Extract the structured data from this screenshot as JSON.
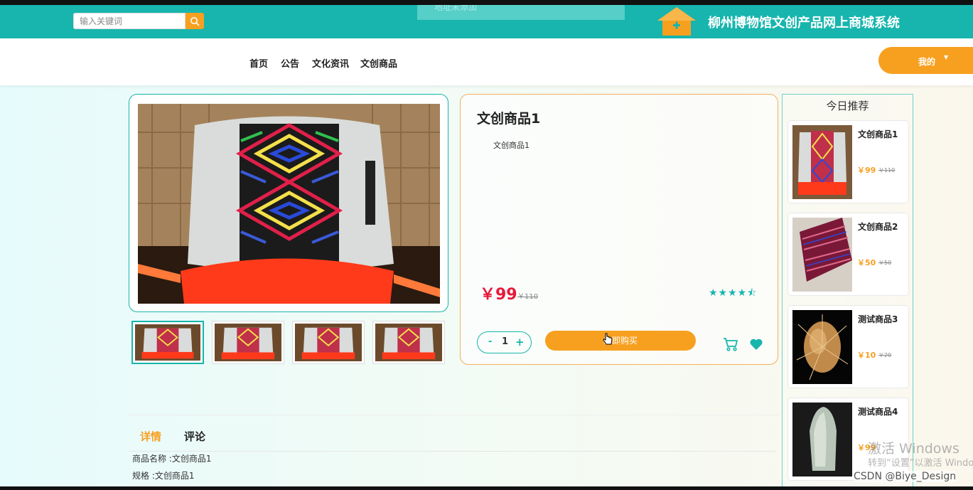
{
  "header": {
    "search_placeholder": "输入关键词",
    "address_text": "地址未添加",
    "site_title": "柳州博物馆文创产品网上商城系统",
    "brand_color": "#17b5ad",
    "accent_color": "#f7a020"
  },
  "nav": {
    "items": [
      {
        "label": "首页"
      },
      {
        "label": "公告"
      },
      {
        "label": "文化资讯"
      },
      {
        "label": "文创商品"
      }
    ],
    "mine_label": "我的",
    "mine_caret": "▼"
  },
  "product": {
    "title": "文创商品1",
    "description": "文创商品1",
    "price": "￥99",
    "old_price": "￥110",
    "rating_stars": "★★★★⯪",
    "rating_value": 4.5,
    "quantity": "1",
    "minus_label": "-",
    "plus_label": "+",
    "buy_label": "立即购买",
    "thumbnails_count": 4
  },
  "recommend": {
    "title": "今日推荐",
    "items": [
      {
        "name": "文创商品1",
        "price": "￥99",
        "old_price": "￥110"
      },
      {
        "name": "文创商品2",
        "price": "￥50",
        "old_price": "￥50"
      },
      {
        "name": "测试商品3",
        "price": "￥10",
        "old_price": "￥20"
      },
      {
        "name": "测试商品4",
        "price": "￥99",
        "old_price": ""
      }
    ]
  },
  "tabs": {
    "items": [
      {
        "label": "详情",
        "active": true
      },
      {
        "label": "评论",
        "active": false
      }
    ],
    "specs": [
      "商品名称 :文创商品1",
      "规格 :文创商品1"
    ]
  },
  "overlay": {
    "watermark_line1": "激活 Windows",
    "watermark_line2": "转到“设置”以激活 Windows。",
    "credit": "CSDN @Biye_Design"
  }
}
